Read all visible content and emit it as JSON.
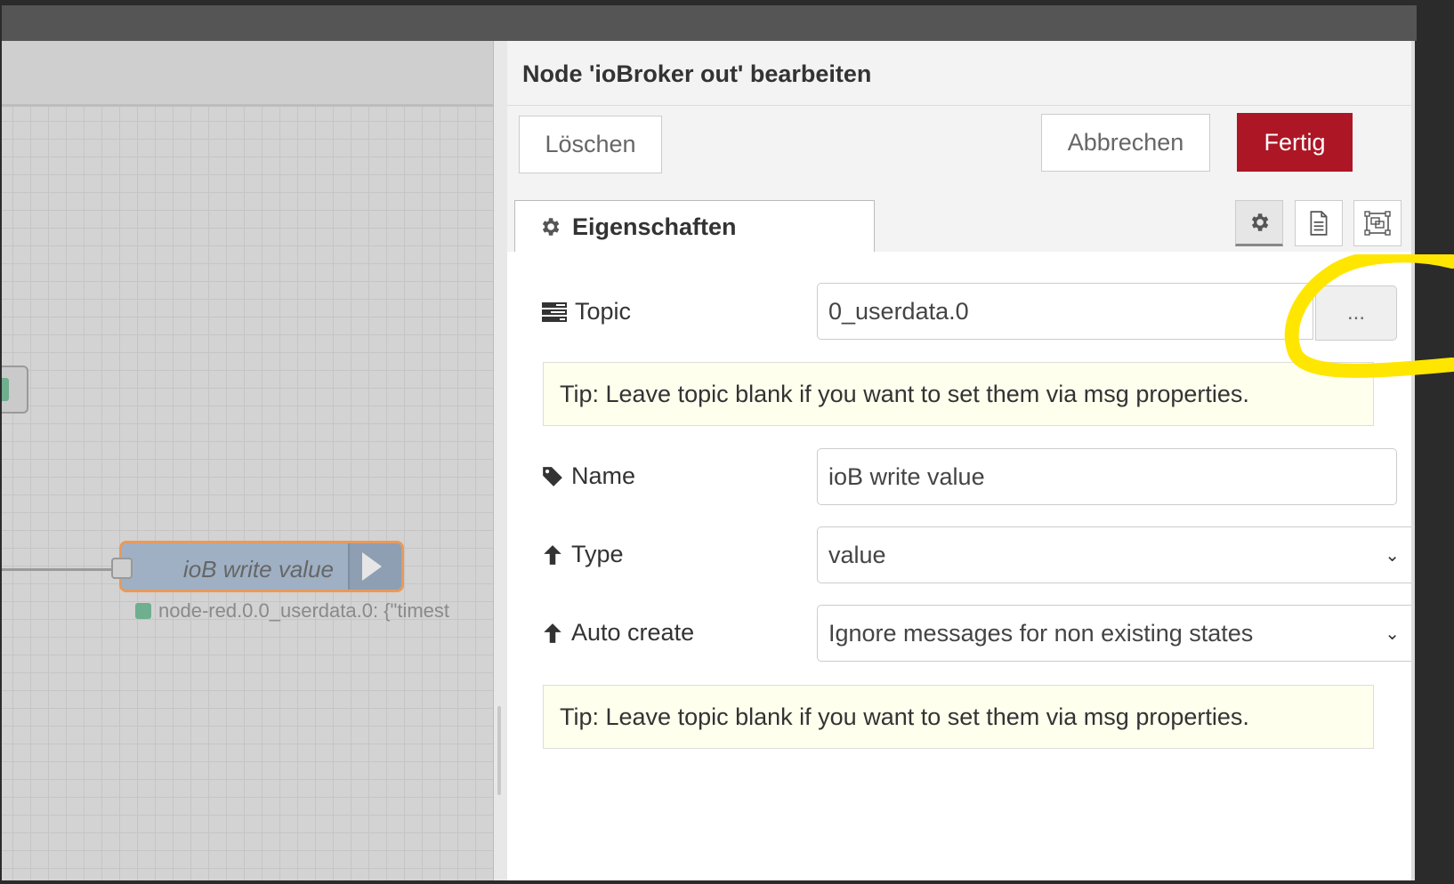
{
  "dialog": {
    "title": "Node 'ioBroker out' bearbeiten",
    "delete_label": "Löschen",
    "cancel_label": "Abbrechen",
    "done_label": "Fertig",
    "tab_label": "Eigenschaften",
    "icon_tabs": [
      "gear-icon",
      "description-icon",
      "appearance-icon"
    ]
  },
  "form": {
    "topic": {
      "label": "Topic",
      "value": "0_userdata.0",
      "browse_label": "..."
    },
    "tip_1": "Tip: Leave topic blank if you want to set them via msg properties.",
    "name": {
      "label": "Name",
      "value": "ioB write value"
    },
    "type": {
      "label": "Type",
      "value": "value"
    },
    "auto_create": {
      "label": "Auto create",
      "value": "Ignore messages for non existing states"
    },
    "tip_2": "Tip: Leave topic blank if you want to set them via msg properties."
  },
  "workspace": {
    "node_label": "ioB write value",
    "node_status": "node-red.0.0_userdata.0: {\"timest"
  },
  "colors": {
    "done_button": "#ad1625",
    "highlight": "#ffe600",
    "node_border": "#e89a5a",
    "status_dot": "#6fae8f"
  }
}
